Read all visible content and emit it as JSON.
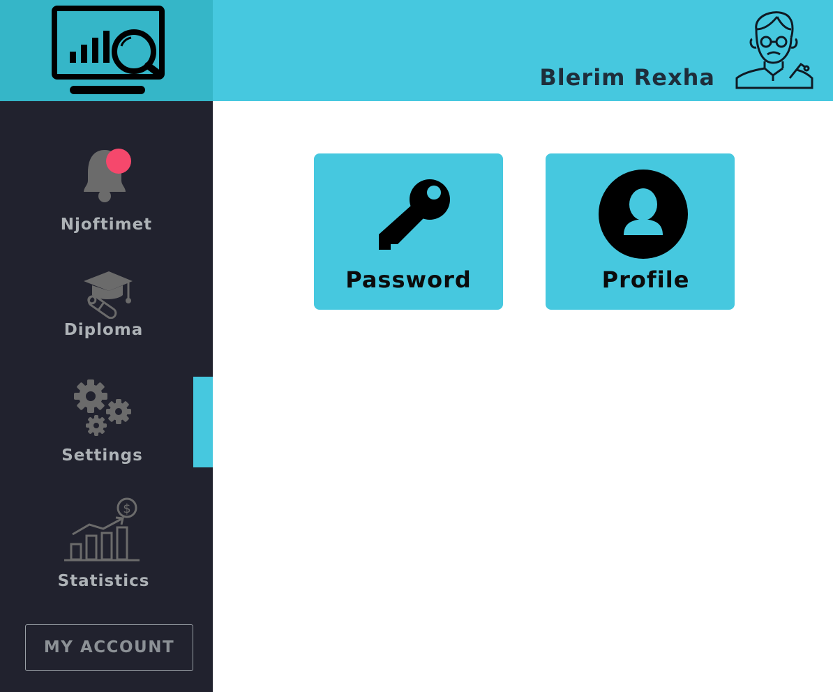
{
  "header": {
    "user_name": "Blerim Rexha",
    "logo_icon": "monitor-chart-search-icon",
    "avatar_icon": "teacher-avatar-icon",
    "color": "#46c8df"
  },
  "sidebar": {
    "items": [
      {
        "label": "Njoftimet",
        "icon": "bell-icon",
        "has_notification": true
      },
      {
        "label": "Diploma",
        "icon": "graduation-cap-diploma-icon"
      },
      {
        "label": "Settings",
        "icon": "gears-icon",
        "active": true
      },
      {
        "label": "Statistics",
        "icon": "statistics-chart-icon"
      }
    ],
    "account_button": "MY ACCOUNT",
    "background": "#21222e",
    "notification_color": "#f5486c"
  },
  "main": {
    "tiles": [
      {
        "label": "Password",
        "icon": "key-icon"
      },
      {
        "label": "Profile",
        "icon": "user-circle-icon"
      }
    ]
  }
}
